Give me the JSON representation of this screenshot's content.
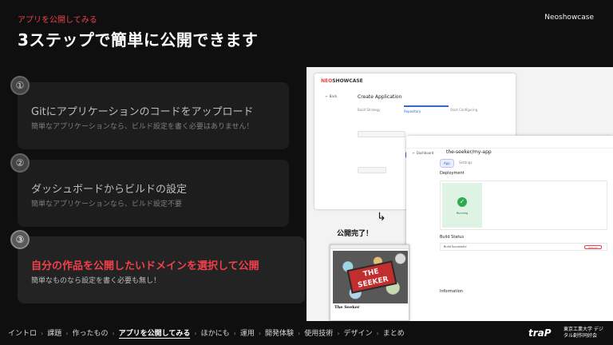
{
  "header": {
    "kicker": "アプリを公開してみる",
    "title": "3ステップで簡単に公開できます",
    "brand": "Neoshowcase"
  },
  "steps": [
    {
      "number": "①",
      "title": "Gitにアプリケーションのコードをアップロード",
      "subtitle": "簡単なアプリケーションなら、ビルド設定を書く必要はありません！"
    },
    {
      "number": "②",
      "title": "ダッシュボードからビルドの設定",
      "subtitle": "簡単なアプリケーションなら、ビルド設定不要"
    },
    {
      "number": "③",
      "title": "自分の作品を公開したいドメインを選択して公開",
      "subtitle": "簡単なものなら設定を書く必要も無し！"
    }
  ],
  "screenshot": {
    "win1": {
      "logo_neo": "NEO",
      "logo_rest": "SHOWCASE",
      "back": "← Back",
      "heading": "Create Application",
      "tabs": [
        "Build Strategy",
        "Repository",
        "Start Configuring"
      ]
    },
    "win2": {
      "back": "← Dashboard",
      "name": "the-seeker/my-app",
      "tab_app": "App",
      "tab_settings": "Settings",
      "deployment": "Deployment",
      "running": "Running",
      "build_status": "Build Status",
      "build_row": "Build Successful",
      "rebuild": "Rebuild",
      "information": "Information"
    },
    "done_label": "公開完了！",
    "arrow": "↳",
    "seeker": {
      "logo": "THE SEEKER",
      "caption": "The Seeker"
    }
  },
  "nav": {
    "items": [
      "イントロ",
      "課題",
      "作ったもの",
      "アプリを公開してみる",
      "ほかにも",
      "運用",
      "開発体験",
      "使用技術",
      "デザイン",
      "まとめ"
    ],
    "separator": "›",
    "current_index": 3
  },
  "footer": {
    "mark": "traP",
    "org": "東京工業大学 デジタル創作同好会"
  }
}
